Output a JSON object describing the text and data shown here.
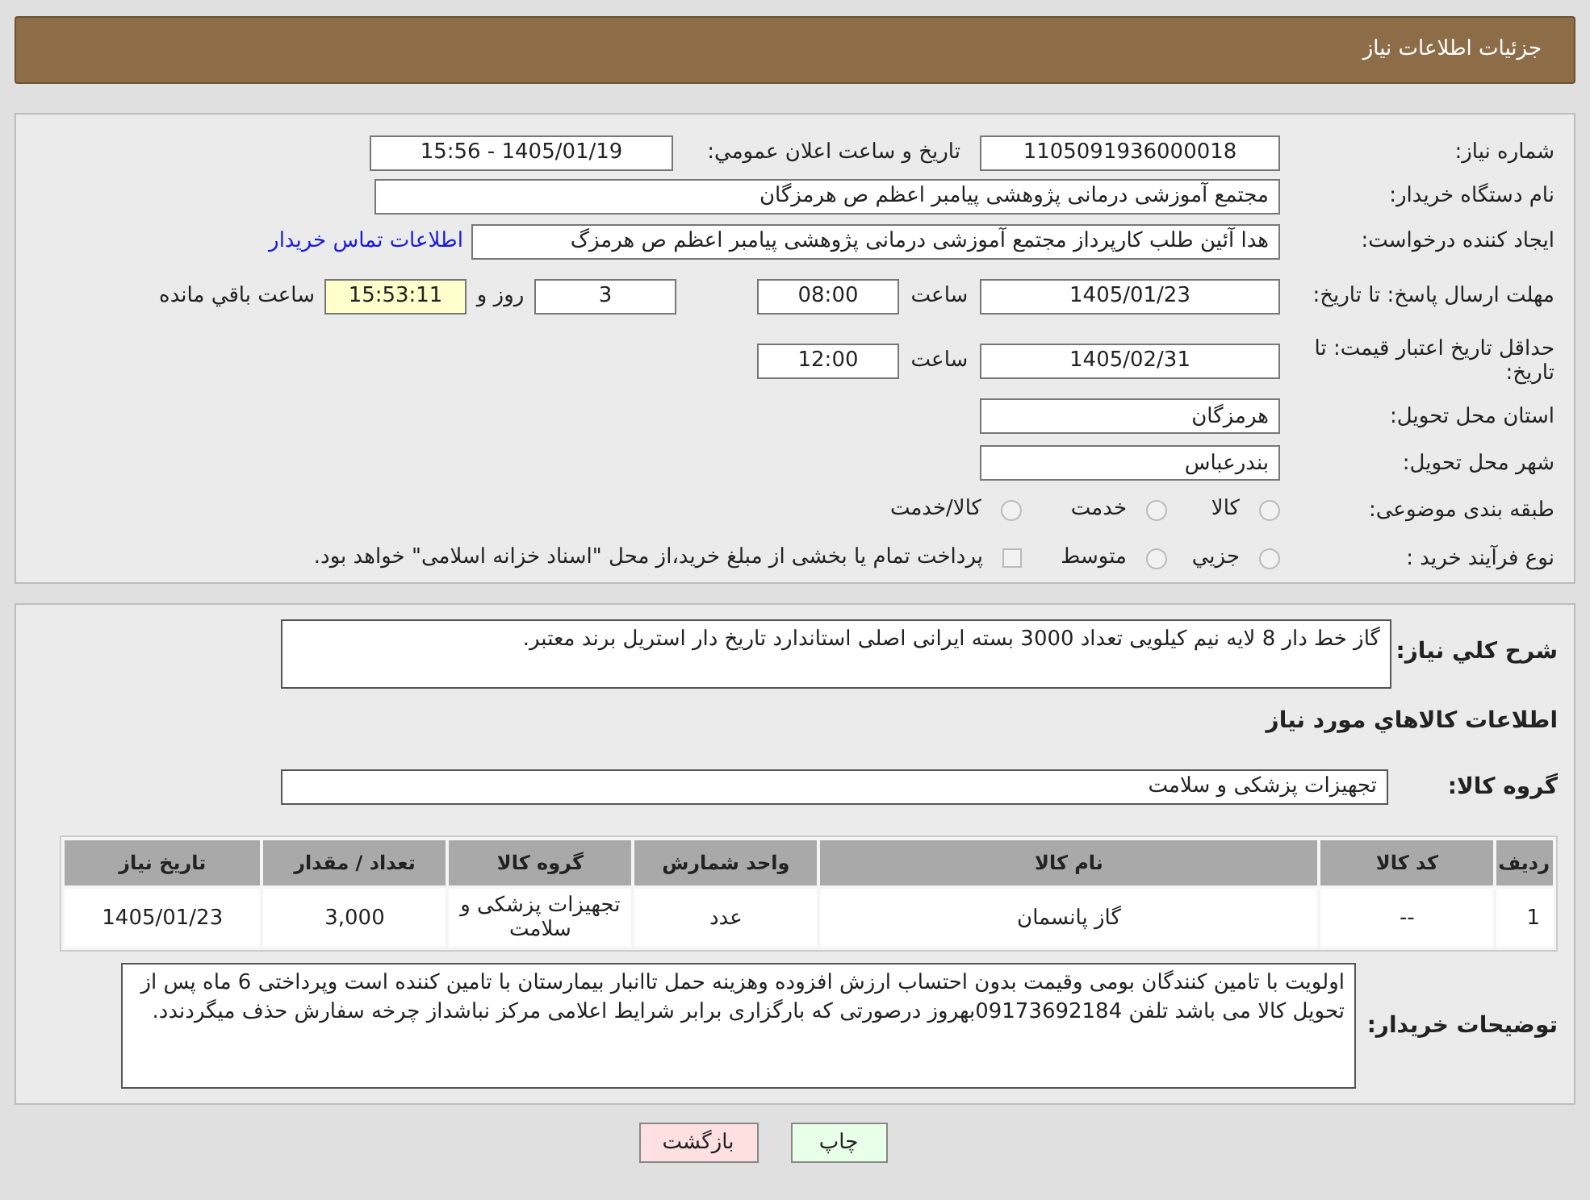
{
  "header": {
    "title": "جزئیات اطلاعات نیاز"
  },
  "need_number": {
    "label": "شماره نیاز:",
    "value": "1105091936000018"
  },
  "announce": {
    "label": "تاریخ و ساعت اعلان عمومي:",
    "value": "1405/01/19 - 15:56"
  },
  "buyer": {
    "label": "نام دستگاه خریدار:",
    "value": "مجتمع آموزشی درمانی پژوهشی پیامبر اعظم ص  هرمزگان"
  },
  "requester": {
    "label": "ایجاد کننده درخواست:",
    "value": "هدا آئین طلب کارپرداز مجتمع آموزشی درمانی پژوهشی پیامبر اعظم ص  هرمزگ",
    "link": "اطلاعات تماس خریدار"
  },
  "reply_deadline": {
    "label": "مهلت ارسال پاسخ: تا تاریخ:",
    "date": "1405/01/23",
    "time_label": "ساعت",
    "time": "08:00",
    "days": "3",
    "days_label": "روز و",
    "remaining": "15:53:11",
    "remaining_label": "ساعت باقي مانده"
  },
  "price_validity": {
    "label": "حداقل تاریخ اعتبار قیمت: تا تاریخ:",
    "date": "1405/02/31",
    "time_label": "ساعت",
    "time": "12:00"
  },
  "province": {
    "label": "استان محل تحویل:",
    "value": "هرمزگان"
  },
  "city": {
    "label": "شهر محل تحویل:",
    "value": "بندرعباس"
  },
  "category": {
    "label": "طبقه بندی موضوعی:",
    "options": [
      {
        "label": "کالا",
        "selected": false
      },
      {
        "label": "خدمت",
        "selected": false
      },
      {
        "label": "کالا/خدمت",
        "selected": false
      }
    ]
  },
  "process": {
    "label": "نوع فرآیند خرید :",
    "options": [
      {
        "kind": "radio",
        "label": "جزيي",
        "selected": false
      },
      {
        "kind": "radio",
        "label": "متوسط",
        "selected": false
      },
      {
        "kind": "checkbox",
        "label": "پرداخت تمام یا بخشی از مبلغ خرید،از محل \"اسناد خزانه اسلامی\" خواهد بود.",
        "selected": false
      }
    ]
  },
  "description": {
    "label": "شرح کلي نياز:",
    "value": "گاز خط دار 8 لایه نیم کیلویی تعداد 3000 بسته ایرانی اصلی استاندارد تاریخ دار استریل برند معتبر."
  },
  "goods_heading": "اطلاعات کالاهاي مورد نياز",
  "goods_group": {
    "label": "گروه کالا:",
    "value": "تجهیزات پزشکی و سلامت"
  },
  "table": {
    "columns": [
      "ردیف",
      "کد کالا",
      "نام کالا",
      "واحد شمارش",
      "گروه کالا",
      "تعداد / مقدار",
      "تاریخ نیاز"
    ],
    "rows": [
      [
        "1",
        "--",
        "گاز پانسمان",
        "عدد",
        "تجهیزات پزشکی و سلامت",
        "3,000",
        "1405/01/23"
      ]
    ]
  },
  "buyer_notes": {
    "label": "توضیحات خریدار:",
    "value": "اولویت با تامین کنندگان بومی وقیمت بدون احتساب ارزش افزوده وهزینه حمل تاانبار بیمارستان با تامین کننده است وپرداختی 6 ماه پس از تحویل کالا می باشد تلفن 09173692184بهروز درصورتی که بارگزاری برابر شرایط اعلامی مرکز نباشداز چرخه سفارش حذف میگردندد."
  },
  "buttons": [
    {
      "kind": "print",
      "label": "چاپ"
    },
    {
      "kind": "back",
      "label": "بازگشت"
    }
  ]
}
